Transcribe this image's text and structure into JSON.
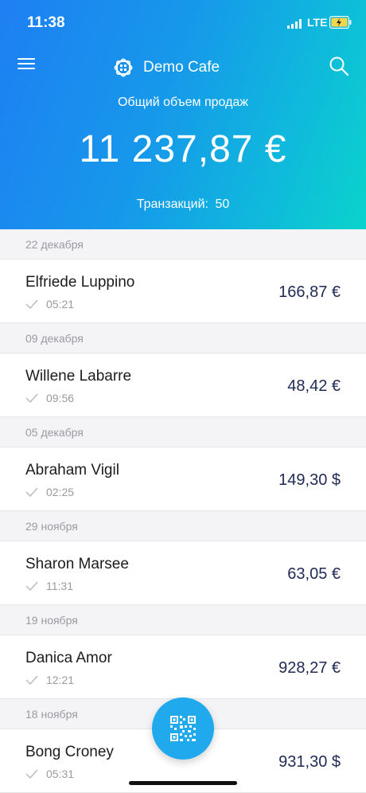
{
  "status_bar": {
    "time": "11:38",
    "network": "LTE"
  },
  "header": {
    "brand_title": "Demo Cafe",
    "sales_label": "Общий объем продаж",
    "sales_amount": "11 237,87 €",
    "transactions_label": "Транзакций:",
    "transactions_count": "50"
  },
  "icons": {
    "menu": "hamburger-menu-icon",
    "search": "search-icon",
    "brand": "cafe-logo-icon",
    "check": "check-icon",
    "qr": "qr-code-icon"
  },
  "colors": {
    "accent": "#21a9ee",
    "amount": "#1f2a55",
    "gradient_start": "#1e7ff3",
    "gradient_end": "#0ad3cc"
  },
  "transactions": [
    {
      "date": "22 декабря",
      "name": "Elfriede Luppino",
      "time": "05:21",
      "amount": "166,87 €"
    },
    {
      "date": "09 декабря",
      "name": "Willene Labarre",
      "time": "09:56",
      "amount": "48,42 €"
    },
    {
      "date": "05 декабря",
      "name": "Abraham Vigil",
      "time": "02:25",
      "amount": "149,30 $"
    },
    {
      "date": "29 ноября",
      "name": "Sharon Marsee",
      "time": "11:31",
      "amount": "63,05 €"
    },
    {
      "date": "19 ноября",
      "name": "Danica Amor",
      "time": "12:21",
      "amount": "928,27 €"
    },
    {
      "date": "18 ноября",
      "name": "Bong Croney",
      "time": "05:31",
      "amount": "931,30 $"
    }
  ]
}
